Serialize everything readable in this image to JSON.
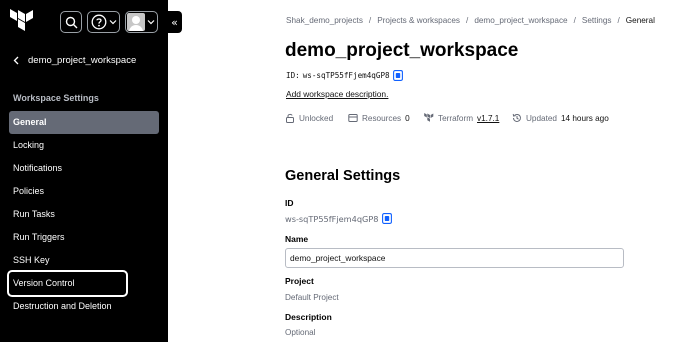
{
  "sidebar": {
    "back_label": "demo_project_workspace",
    "section_title": "Workspace Settings",
    "items": [
      {
        "label": "General"
      },
      {
        "label": "Locking"
      },
      {
        "label": "Notifications"
      },
      {
        "label": "Policies"
      },
      {
        "label": "Run Tasks"
      },
      {
        "label": "Run Triggers"
      },
      {
        "label": "SSH Key"
      },
      {
        "label": "Version Control"
      },
      {
        "label": "Destruction and Deletion"
      }
    ],
    "active_item": "General",
    "highlighted_item": "Version Control",
    "collapse_glyph": "«"
  },
  "topbar": {
    "icons": [
      "terraform-logo-icon",
      "search-icon",
      "help-icon",
      "user-avatar-icon"
    ]
  },
  "breadcrumb": {
    "items": [
      "Shak_demo_projects",
      "Projects & workspaces",
      "demo_project_workspace",
      "Settings",
      "General"
    ],
    "separator": "/"
  },
  "workspace": {
    "title": "demo_project_workspace",
    "id_prefix": "ID:",
    "id_value": "ws-sqTP55fFjem4qGP8",
    "add_description": "Add workspace description."
  },
  "meta": {
    "lock_status": "Unlocked",
    "resources_label": "Resources",
    "resources_count": "0",
    "terraform_label": "Terraform",
    "terraform_version": "v1.7.1",
    "updated_label": "Updated",
    "updated_value": "14 hours ago"
  },
  "general_settings": {
    "title": "General Settings",
    "id_label": "ID",
    "id_value": "ws-sqTP55fFjem4qGP8",
    "name_label": "Name",
    "name_value": "demo_project_workspace",
    "project_label": "Project",
    "project_value": "Default Project",
    "description_label": "Description",
    "description_value": "Optional"
  },
  "colors": {
    "sidebar_bg": "#000000",
    "active_item_bg": "#656a76",
    "accent_blue": "#1060ff",
    "muted_text": "#656a76"
  }
}
